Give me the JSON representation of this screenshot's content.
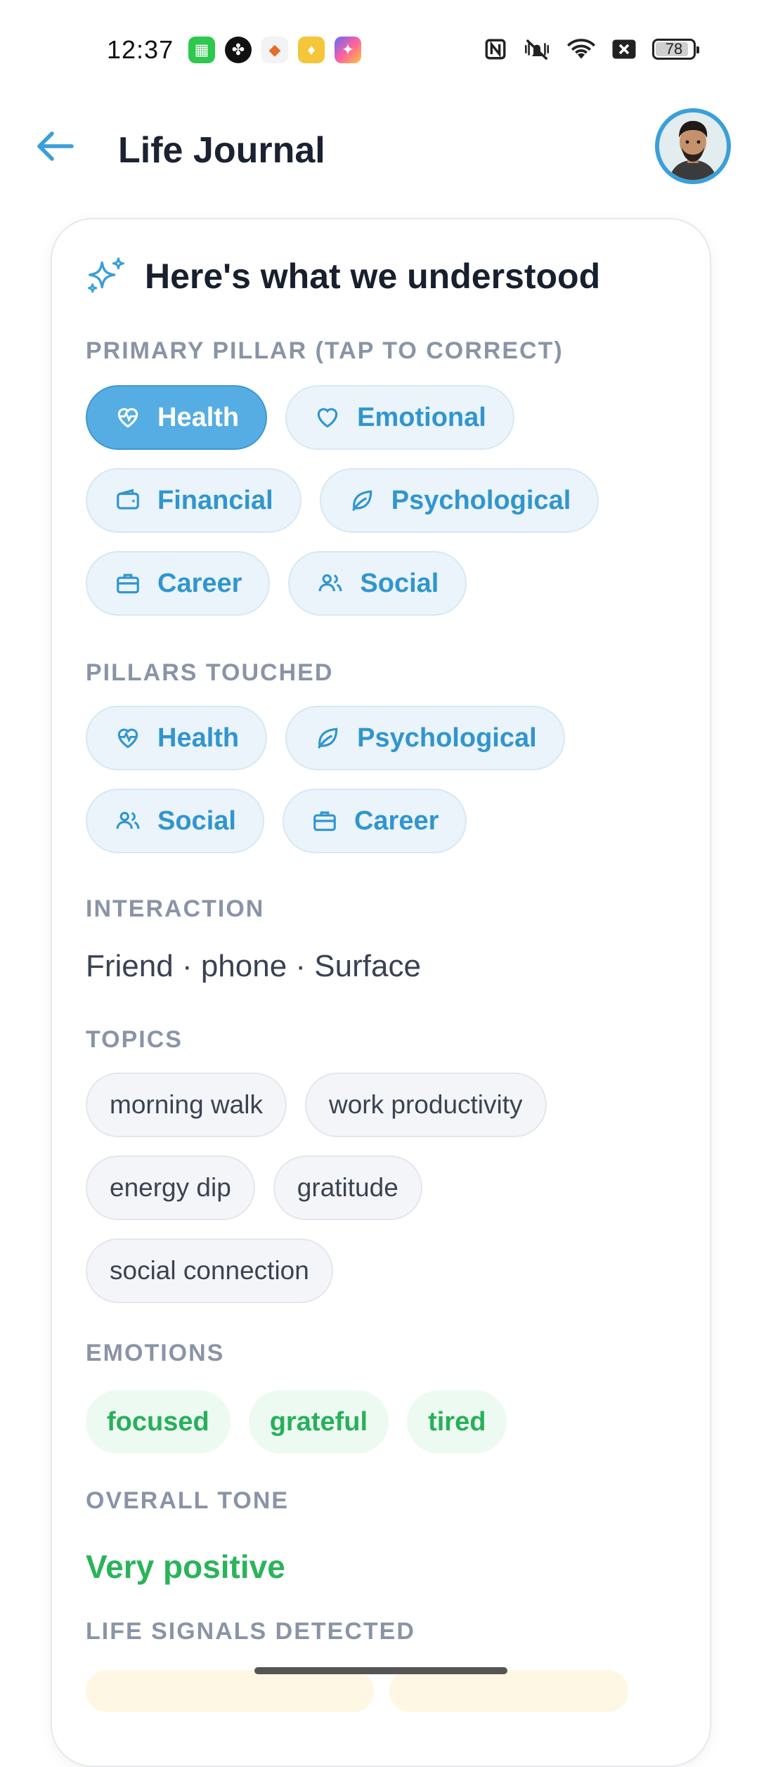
{
  "status_bar": {
    "time": "12:37",
    "battery": "78",
    "notification_icons": [
      "calculator-app-icon",
      "clover-app-icon",
      "game-app-icon",
      "rewards-app-icon",
      "assistant-app-icon"
    ],
    "system_icons": [
      "nfc-icon",
      "mute-vibrate-icon",
      "wifi-icon",
      "no-sim-icon",
      "battery-icon"
    ]
  },
  "header": {
    "title": "Life Journal",
    "back_icon": "arrow-left-icon"
  },
  "card": {
    "title": "Here's what we understood",
    "title_icon": "sparkles-icon",
    "primary_pillar": {
      "label": "PRIMARY PILLAR (TAP TO CORRECT)",
      "selected": "Health",
      "options": [
        {
          "label": "Health",
          "icon": "heart-pulse-icon",
          "selected": true
        },
        {
          "label": "Emotional",
          "icon": "heart-icon",
          "selected": false
        },
        {
          "label": "Financial",
          "icon": "wallet-icon",
          "selected": false
        },
        {
          "label": "Psychological",
          "icon": "leaf-icon",
          "selected": false
        },
        {
          "label": "Career",
          "icon": "briefcase-icon",
          "selected": false
        },
        {
          "label": "Social",
          "icon": "users-icon",
          "selected": false
        }
      ]
    },
    "pillars_touched": {
      "label": "PILLARS TOUCHED",
      "items": [
        {
          "label": "Health",
          "icon": "heart-pulse-icon"
        },
        {
          "label": "Psychological",
          "icon": "leaf-icon"
        },
        {
          "label": "Social",
          "icon": "users-icon"
        },
        {
          "label": "Career",
          "icon": "briefcase-icon"
        }
      ]
    },
    "interaction": {
      "label": "INTERACTION",
      "value": "Friend · phone · Surface"
    },
    "topics": {
      "label": "TOPICS",
      "items": [
        "morning walk",
        "work productivity",
        "energy dip",
        "gratitude",
        "social connection"
      ]
    },
    "emotions": {
      "label": "EMOTIONS",
      "items": [
        "focused",
        "grateful",
        "tired"
      ]
    },
    "overall_tone": {
      "label": "OVERALL TONE",
      "value": "Very positive"
    },
    "life_signals": {
      "label": "LIFE SIGNALS DETECTED"
    }
  },
  "colors": {
    "accent": "#3195cf",
    "selected_chip": "#55ade3",
    "positive": "#2bb35b",
    "section_label": "#8a94a6"
  }
}
